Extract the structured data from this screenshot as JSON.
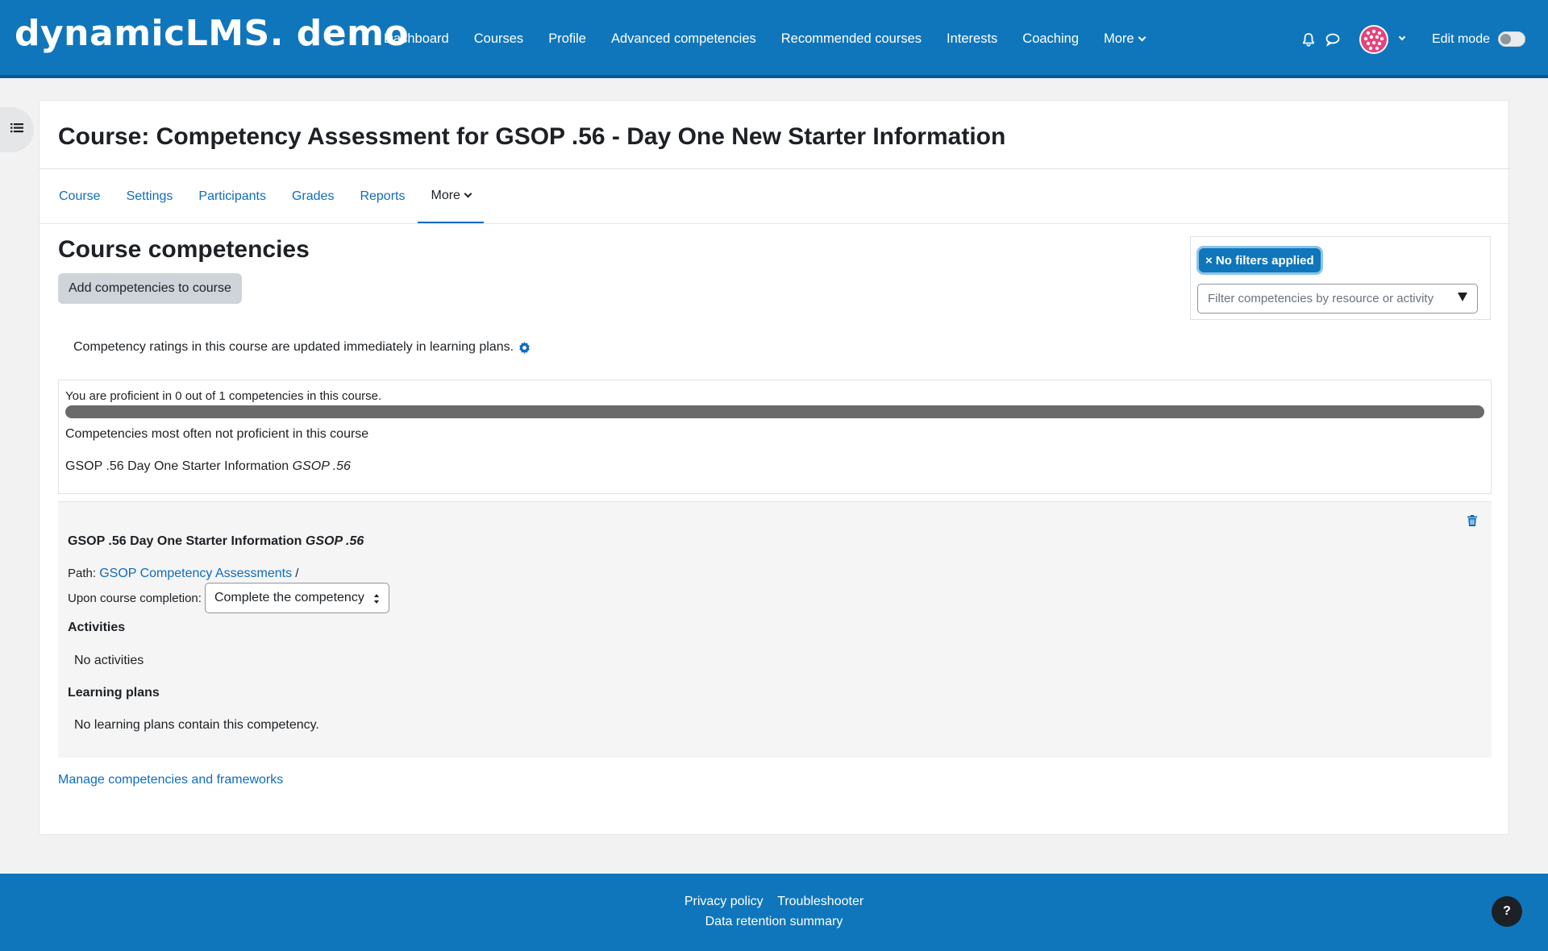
{
  "brand": "dynamicLMS. demo",
  "primary_nav": [
    "Dashboard",
    "Courses",
    "Profile",
    "Advanced competencies",
    "Recommended courses",
    "Interests",
    "Coaching"
  ],
  "primary_nav_more": "More",
  "edit_mode_label": "Edit mode",
  "course_title": "Course: Competency Assessment for GSOP .56 - Day One New Starter Information",
  "secondary_nav": [
    "Course",
    "Settings",
    "Participants",
    "Grades",
    "Reports"
  ],
  "secondary_nav_more": "More",
  "section_heading": "Course competencies",
  "add_button": "Add competencies to course",
  "filter": {
    "chip": "× No filters applied",
    "placeholder": "Filter competencies by resource or activity"
  },
  "rating_note": "Competency ratings in this course are updated immediately in learning plans.",
  "summary": {
    "proficient_line": "You are proficient in 0 out of 1 competencies in this course.",
    "progress_fraction": 0,
    "subheading": "Competencies most often not proficient in this course",
    "item_name": "GSOP .56 Day One Starter Information",
    "item_id": "GSOP .56"
  },
  "competency": {
    "name": "GSOP .56 Day One Starter Information",
    "id": "GSOP .56",
    "path_label": "Path:",
    "path_link": "GSOP Competency Assessments",
    "path_sep": "/",
    "completion_label": "Upon course completion:",
    "completion_value": "Complete the competency",
    "activities_heading": "Activities",
    "activities_text": "No activities",
    "plans_heading": "Learning plans",
    "plans_text": "No learning plans contain this competency."
  },
  "manage_link": "Manage competencies and frameworks",
  "footer": {
    "privacy": "Privacy policy",
    "troubleshooter": "Troubleshooter",
    "retention": "Data retention summary",
    "help": "?"
  },
  "colors": {
    "brand_blue": "#0f76bc",
    "link_blue": "#0f6cbf",
    "progress_track": "#6a6a6a"
  },
  "icons": [
    "bell-icon",
    "chat-icon",
    "globe-avatar-icon",
    "chevron-down-icon",
    "list-drawer-icon",
    "gear-icon",
    "trash-icon",
    "question-icon"
  ]
}
